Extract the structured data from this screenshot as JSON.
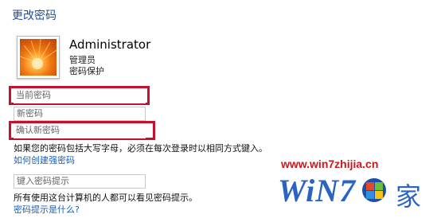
{
  "page": {
    "title": "更改密码"
  },
  "account": {
    "name": "Administrator",
    "role": "管理员",
    "status": "密码保护"
  },
  "fields": {
    "current_password_placeholder": "当前密码",
    "new_password_placeholder": "新密码",
    "confirm_password_placeholder": "确认新密码",
    "hint_placeholder": "键入密码提示"
  },
  "notes": {
    "caps_warning": "如果您的密码包括大写字母，必须在每次登录时以相同方式键入。",
    "strong_password_link": "如何创建强密码",
    "hint_visibility": "所有使用这台计算机的人都可以看见密码提示。",
    "what_is_hint_link": "密码提示是什么?"
  },
  "watermark": {
    "url": "www.win7zhijia.cn",
    "logo": "WiN7",
    "glyph": "家"
  },
  "colors": {
    "title": "#1e4e9c",
    "link": "#1e5fb3",
    "highlight": "#c8102e",
    "watermark_url": "#d0161b",
    "watermark_logo": "#2a63c4"
  }
}
